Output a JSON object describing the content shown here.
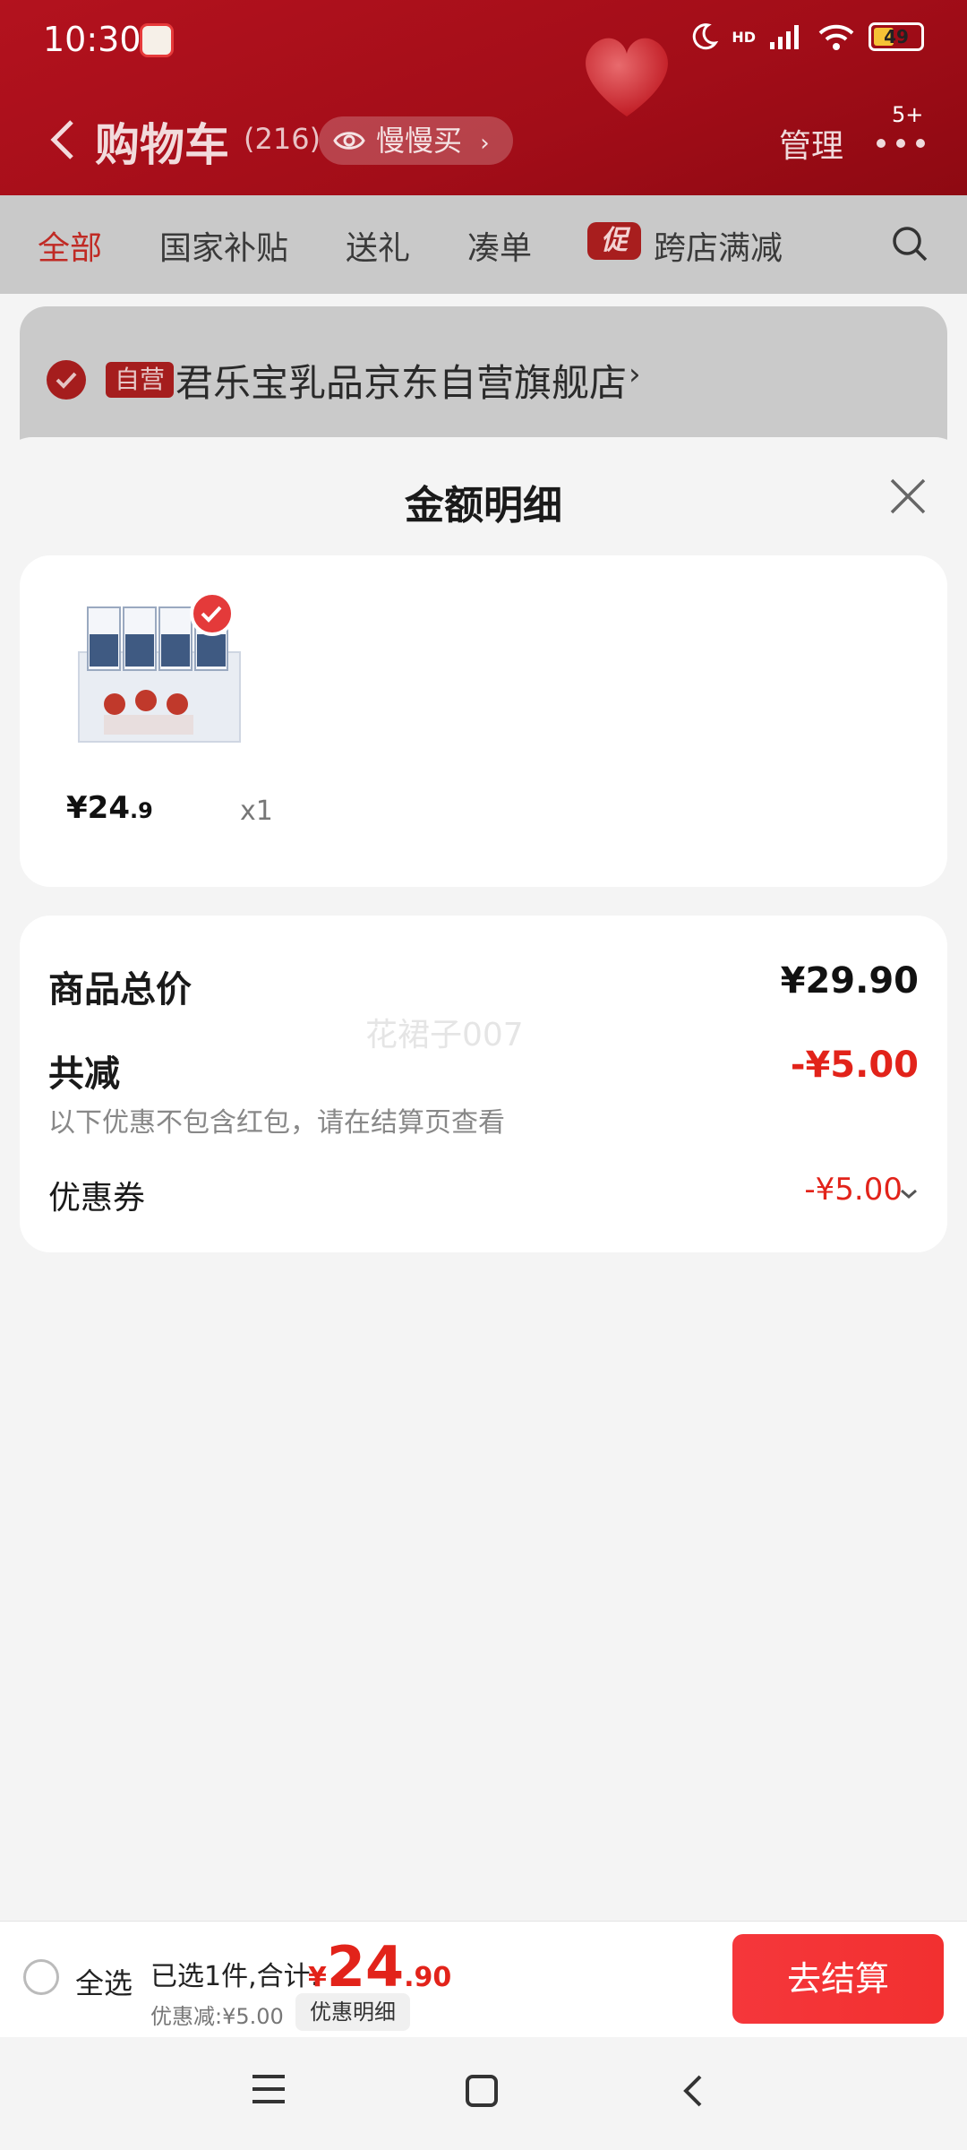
{
  "status_bar": {
    "time": "10:30",
    "signal_label": "HD",
    "battery": "49"
  },
  "header": {
    "back_icon": "chevron-left-icon",
    "title": "购物车",
    "count": "(216)",
    "slow_buy_label": "慢慢买",
    "manage_label": "管理",
    "more_badge": "5+"
  },
  "tabs": [
    {
      "label": "全部",
      "active": true
    },
    {
      "label": "国家补贴"
    },
    {
      "label": "送礼"
    },
    {
      "label": "凑单"
    },
    {
      "label": "跨店满减",
      "badge": "促"
    }
  ],
  "store": {
    "tag": "自营",
    "name": "君乐宝乳品京东自营旗舰店"
  },
  "sheet": {
    "title": "金额明细",
    "product": {
      "price_int": "¥24",
      "price_dec": ".9",
      "quantity": "x1"
    },
    "summary": {
      "total_label": "商品总价",
      "total_value": "¥29.90",
      "reduce_label": "共减",
      "reduce_value": "-¥5.00",
      "note": "以下优惠不包含红包，请在结算页查看",
      "coupon_label": "优惠券",
      "coupon_value": "-¥5.00"
    },
    "watermark": "花裙子007"
  },
  "bottom_bar": {
    "select_all": "全选",
    "selected_text": "已选1件,合计:",
    "total_symbol": "¥",
    "total_int": "24",
    "total_dec": ".90",
    "discount_text": "优惠减:¥5.00",
    "detail_button": "优惠明细",
    "checkout_button": "去结算"
  },
  "colors": {
    "brand_red": "#e2231a",
    "header_red": "#a20d18",
    "checkout_red": "#f23030"
  }
}
